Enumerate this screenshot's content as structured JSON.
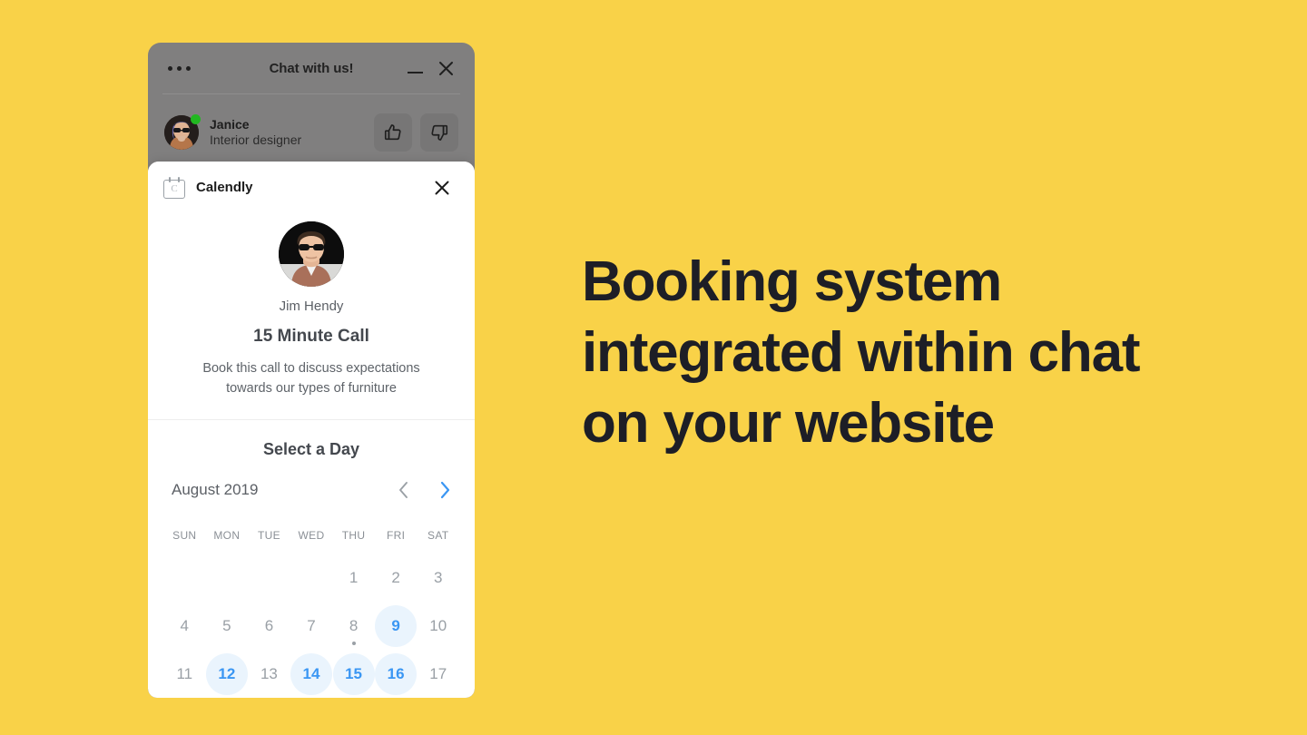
{
  "theme": {
    "background_color": "#f9d248",
    "chat_overlay_color": "#807f7f",
    "accent_blue": "#3a96f3",
    "available_day_bg": "#eaf4fd",
    "online_dot_color": "#21b820",
    "headline_color": "#1d1e26"
  },
  "chat": {
    "title": "Chat with us!",
    "menu_icon": "ellipsis-icon",
    "minimize_icon": "minimize-icon",
    "close_icon": "close-icon",
    "agent": {
      "name": "Janice",
      "role": "Interior designer",
      "avatar_icon": "agent-avatar",
      "status": "online"
    },
    "feedback": {
      "thumbs_up_icon": "thumbs-up-icon",
      "thumbs_down_icon": "thumbs-down-icon"
    }
  },
  "calendly": {
    "brand": "Calendly",
    "brand_icon": "calendar-c-icon",
    "brand_icon_letter": "C",
    "close_icon": "close-icon",
    "host_name": "Jim Hendy",
    "event_title": "15 Minute Call",
    "event_description": "Book this call to discuss expectations towards our types of furniture",
    "select_day_heading": "Select a Day",
    "month_label": "August 2019",
    "prev_month_icon": "chevron-left-icon",
    "next_month_icon": "chevron-right-icon",
    "prev_month_enabled": false,
    "next_month_enabled": true,
    "weekdays": [
      "SUN",
      "MON",
      "TUE",
      "WED",
      "THU",
      "FRI",
      "SAT"
    ],
    "weeks": [
      [
        {
          "label": "",
          "empty": true
        },
        {
          "label": "",
          "empty": true
        },
        {
          "label": "",
          "empty": true
        },
        {
          "label": "",
          "empty": true
        },
        {
          "label": "1",
          "available": false
        },
        {
          "label": "2",
          "available": false
        },
        {
          "label": "3",
          "available": false
        }
      ],
      [
        {
          "label": "4",
          "available": false
        },
        {
          "label": "5",
          "available": false
        },
        {
          "label": "6",
          "available": false
        },
        {
          "label": "7",
          "available": false
        },
        {
          "label": "8",
          "available": false,
          "today": true
        },
        {
          "label": "9",
          "available": true
        },
        {
          "label": "10",
          "available": false
        }
      ],
      [
        {
          "label": "11",
          "available": false
        },
        {
          "label": "12",
          "available": true
        },
        {
          "label": "13",
          "available": false
        },
        {
          "label": "14",
          "available": true
        },
        {
          "label": "15",
          "available": true
        },
        {
          "label": "16",
          "available": true
        },
        {
          "label": "17",
          "available": false
        }
      ]
    ]
  },
  "headline": {
    "text": "Booking system integrated within chat on your website"
  }
}
